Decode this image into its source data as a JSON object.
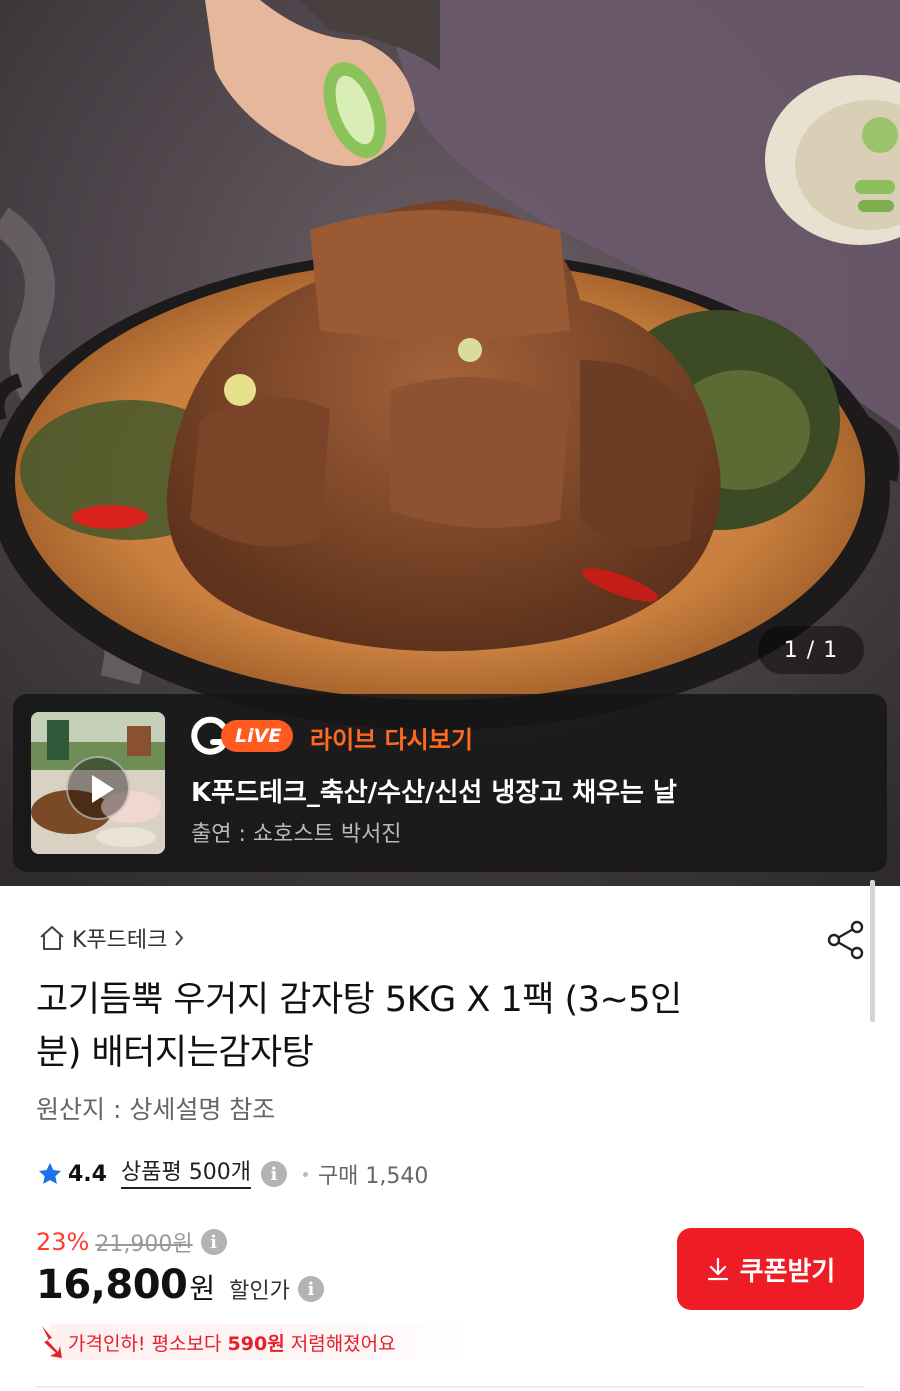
{
  "hero": {
    "image_counter": "1 / 1"
  },
  "live": {
    "badge": "LiVE",
    "replay_label": "라이브 다시보기",
    "title": "K푸드테크_축산/수산/신선 냉장고 채우는 날",
    "host": "출연 : 쇼호스트 박서진"
  },
  "store": {
    "name": "K푸드테크"
  },
  "product": {
    "title_line1": "고기듬뿍 우거지 감자탕 5KG X 1팩 (3~5인",
    "title_line2": "분) 배터지는감자탕",
    "origin": "원산지 : 상세설명 참조"
  },
  "rating": {
    "score": "4.4",
    "review_label": "상품평 500개",
    "purchase": "구매 1,540"
  },
  "price": {
    "discount_rate": "23%",
    "original": "21,900원",
    "current": "16,800",
    "currency": "원",
    "label": "할인가",
    "info_glyph": "i"
  },
  "coupon": {
    "label": "쿠폰받기"
  },
  "price_drop": {
    "prefix": "가격인하! 평소보다 ",
    "amount": "590원",
    "suffix": " 저렴해졌어요"
  },
  "colors": {
    "accent_red": "#ee1c25",
    "live_orange": "#ff6a1f",
    "star_blue": "#1a73e8"
  }
}
